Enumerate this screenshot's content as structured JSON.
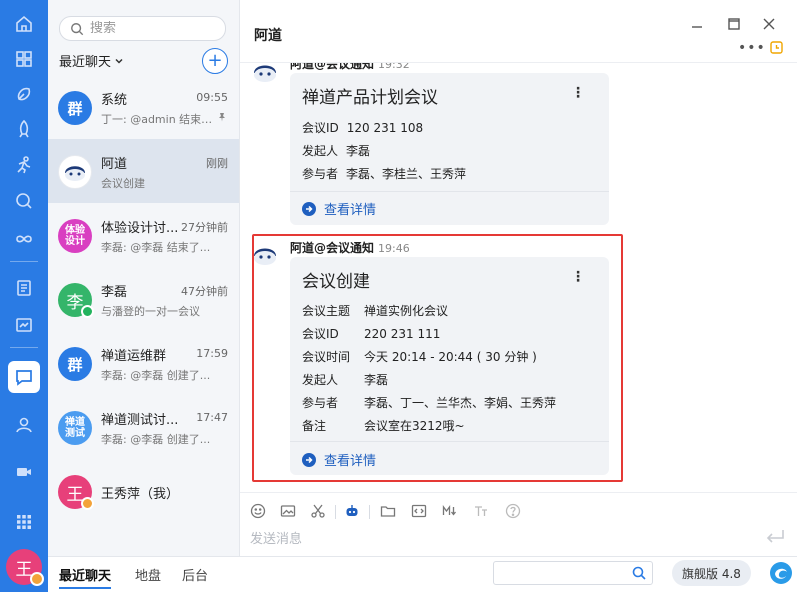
{
  "colors": {
    "accent": "#2a7be4",
    "highlight": "#e53935",
    "link": "#1f5fbf"
  },
  "rail": {
    "icons": [
      "home-icon",
      "apps-icon",
      "product-icon",
      "rocket-icon",
      "run-icon",
      "search-circle-icon",
      "infinity-icon",
      "doc-icon",
      "board-icon",
      "chat-icon",
      "user-icon",
      "video-icon",
      "grid-icon"
    ],
    "me_avatar": "王"
  },
  "search": {
    "placeholder": "搜索"
  },
  "list": {
    "filter_label": "最近聊天",
    "add_label": "+",
    "items": [
      {
        "avatar": "群",
        "color": "#2a7be4",
        "name": "系统",
        "time": "09:55",
        "preview": "丁一: @admin 结束了..."
      },
      {
        "avatar": "",
        "color": "#ffffff",
        "name": "阿道",
        "time": "刚刚",
        "preview": "会议创建"
      },
      {
        "avatar": "体验设计",
        "color": "#d93fc1",
        "name": "体验设计讨...",
        "time": "27分钟前",
        "preview": "李磊: @李磊 结束了..."
      },
      {
        "avatar": "李",
        "color": "#34b56a",
        "name": "李磊",
        "time": "47分钟前",
        "preview": "与潘登的一对一会议"
      },
      {
        "avatar": "群",
        "color": "#2a7be4",
        "name": "禅道运维群",
        "time": "17:59",
        "preview": "李磊: @李磊 创建了..."
      },
      {
        "avatar": "禅道测试",
        "color": "#4b9cf0",
        "name": "禅道测试讨...",
        "time": "17:47",
        "preview": "李磊: @李磊 创建了..."
      },
      {
        "avatar": "王",
        "color": "#e7407a",
        "name": "王秀萍（我）",
        "time": "",
        "preview": ""
      }
    ]
  },
  "conversation": {
    "title": "阿道",
    "more_label": "•••",
    "messages": [
      {
        "sender": "阿道@会议通知",
        "time": "19:32",
        "card_title": "禅道产品计划会议",
        "rows": [
          {
            "k": "会议ID",
            "v": "120 231 108"
          },
          {
            "k": "发起人",
            "v": "李磊"
          },
          {
            "k": "参与者",
            "v": "李磊、李桂兰、王秀萍"
          }
        ],
        "detail": "查看详情"
      },
      {
        "sender": "阿道@会议通知",
        "time": "19:46",
        "card_title": "会议创建",
        "rows": [
          {
            "k": "会议主题",
            "v": "禅道实例化会议"
          },
          {
            "k": "会议ID",
            "v": "220 231 111"
          },
          {
            "k": "会议时间",
            "v": "今天 20:14 - 20:44 ( 30 分钟 )"
          },
          {
            "k": "发起人",
            "v": "李磊"
          },
          {
            "k": "参与者",
            "v": "李磊、丁一、兰华杰、李娟、王秀萍"
          },
          {
            "k": "备注",
            "v": "会议室在3212哦~"
          }
        ],
        "detail": "查看详情"
      }
    ],
    "card_more": "⋮",
    "input_placeholder": "发送消息"
  },
  "bottom": {
    "tabs": [
      "最近聊天",
      "地盘",
      "后台"
    ],
    "edition": "旗舰版 4.8"
  }
}
